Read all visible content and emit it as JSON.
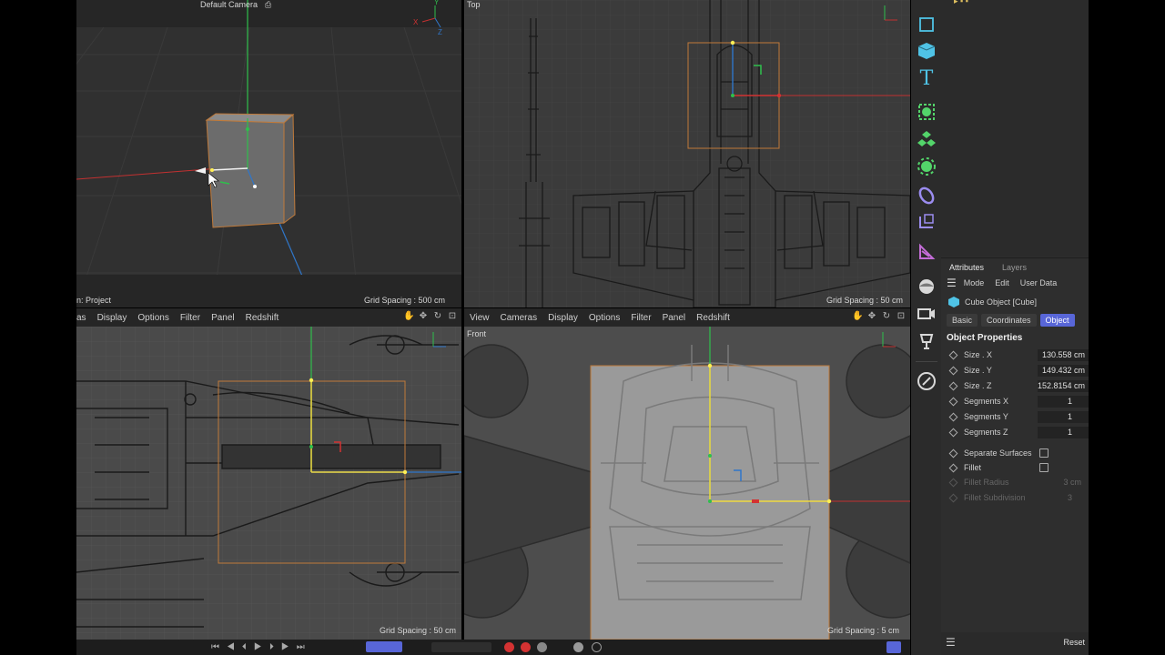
{
  "viewports": {
    "perspective": {
      "camera_label": "Default Camera",
      "grid_spacing": "Grid Spacing : 500 cm",
      "bottom_left": "n: Project"
    },
    "top": {
      "label": "Top",
      "grid_spacing": "Grid Spacing : 50 cm"
    },
    "right": {
      "grid_spacing": "Grid Spacing : 50 cm",
      "menu": [
        "as",
        "Display",
        "Options",
        "Filter",
        "Panel",
        "Redshift"
      ]
    },
    "front": {
      "label": "Front",
      "grid_spacing": "Grid Spacing : 5 cm",
      "menu": [
        "View",
        "Cameras",
        "Display",
        "Options",
        "Filter",
        "Panel",
        "Redshift"
      ]
    }
  },
  "axes": {
    "x": "X",
    "y": "Y",
    "z": "Z"
  },
  "toolbar_icons": [
    "cube-primitive-icon",
    "cube-icon",
    "text-icon",
    "spline-pen-icon",
    "generator-icon",
    "deformer-icon",
    "field-icon",
    "environment-icon",
    "volume-icon",
    "sphere-icon",
    "camera-icon",
    "light-icon",
    "sketch-icon"
  ],
  "attributes": {
    "tabs": [
      "Attributes",
      "Layers"
    ],
    "menu": [
      "Mode",
      "Edit",
      "User Data"
    ],
    "object_title": "Cube Object [Cube]",
    "subtabs": [
      "Basic",
      "Coordinates",
      "Object"
    ],
    "active_subtab": "Object",
    "section_title": "Object Properties",
    "fields": [
      {
        "label": "Size . X",
        "value": "130.558 cm"
      },
      {
        "label": "Size . Y",
        "value": "149.432 cm"
      },
      {
        "label": "Size . Z",
        "value": "152.8154 cm"
      },
      {
        "label": "Segments X",
        "value": "1"
      },
      {
        "label": "Segments Y",
        "value": "1"
      },
      {
        "label": "Segments Z",
        "value": "1"
      }
    ],
    "checks": [
      {
        "label": "Separate Surfaces"
      },
      {
        "label": "Fillet"
      }
    ],
    "disabled": [
      {
        "label": "Fillet Radius",
        "value": "3 cm"
      },
      {
        "label": "Fillet Subdivision",
        "value": "3"
      }
    ],
    "reset_label": "Reset"
  },
  "colors": {
    "accent": "#5866d8",
    "x_axis": "#d33232",
    "y_axis": "#2fbf4c",
    "z_axis": "#2f76c9",
    "selection": "#f0d940"
  }
}
